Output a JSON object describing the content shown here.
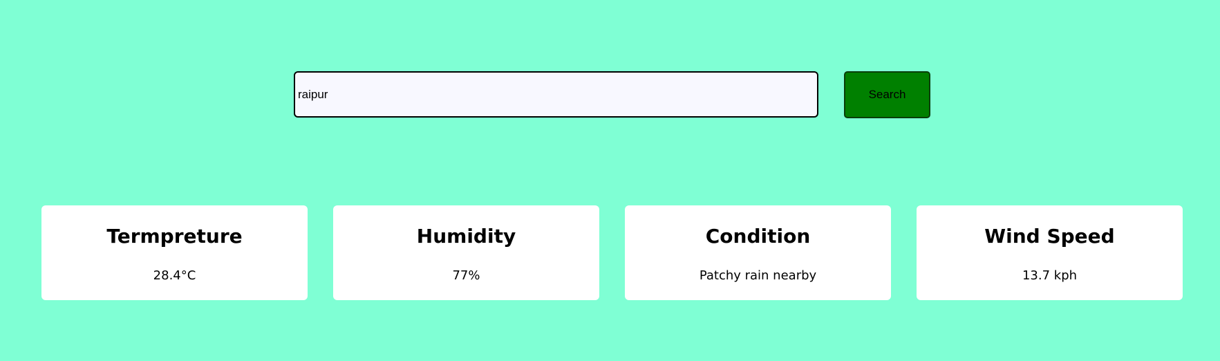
{
  "search": {
    "value": "raipur",
    "placeholder": "",
    "button_label": "Search"
  },
  "cards": [
    {
      "title": "Termpreture",
      "value": "28.4°C"
    },
    {
      "title": "Humidity",
      "value": "77%"
    },
    {
      "title": "Condition",
      "value": "Patchy rain nearby"
    },
    {
      "title": "Wind Speed",
      "value": "13.7 kph"
    }
  ],
  "colors": {
    "background": "#7fffd4",
    "search_button": "#008000",
    "input_background": "#f8f8ff",
    "card_background": "#ffffff"
  }
}
